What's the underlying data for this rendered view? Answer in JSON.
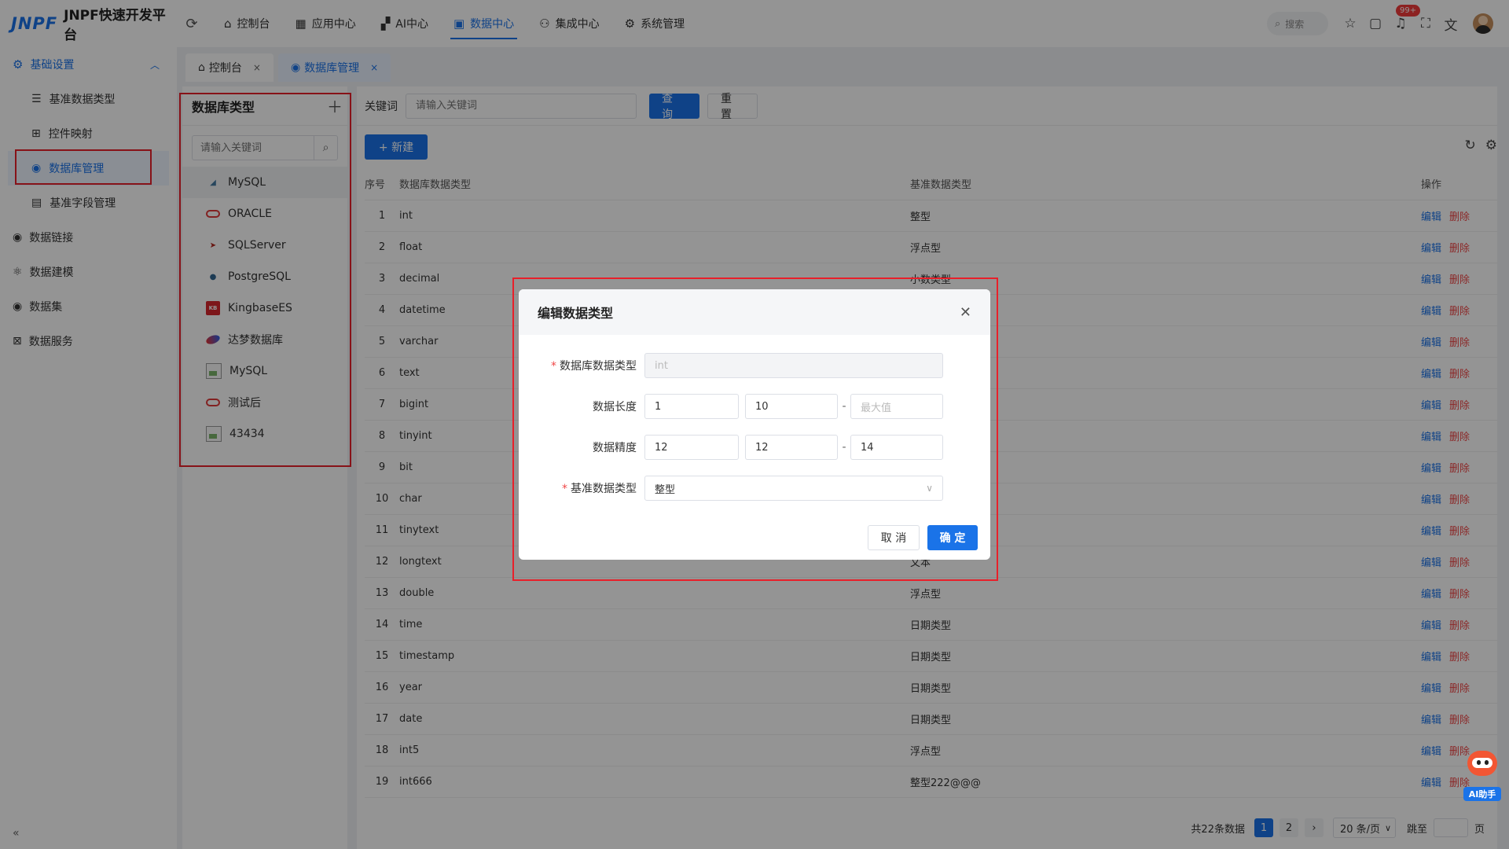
{
  "header": {
    "logo_mark": "JNPF",
    "app_title": "JNPF快速开发平台",
    "nav": [
      {
        "label": "控制台",
        "icon": "home-icon"
      },
      {
        "label": "应用中心",
        "icon": "grid-icon"
      },
      {
        "label": "AI中心",
        "icon": "ai-icon"
      },
      {
        "label": "数据中心",
        "icon": "data-icon",
        "active": true
      },
      {
        "label": "集成中心",
        "icon": "integration-icon"
      },
      {
        "label": "系统管理",
        "icon": "gear-icon"
      }
    ],
    "search_placeholder": "搜索",
    "notification_badge": "99+"
  },
  "sidebar": {
    "group_label": "基础设置",
    "group_items": [
      {
        "label": "基准数据类型"
      },
      {
        "label": "控件映射"
      },
      {
        "label": "数据库管理",
        "active": true
      },
      {
        "label": "基准字段管理"
      }
    ],
    "top_items": [
      {
        "label": "数据链接"
      },
      {
        "label": "数据建模"
      },
      {
        "label": "数据集"
      },
      {
        "label": "数据服务"
      }
    ]
  },
  "tabs": [
    {
      "label": "控制台"
    },
    {
      "label": "数据库管理",
      "active": true
    }
  ],
  "db_panel": {
    "title": "数据库类型",
    "search_placeholder": "请输入关键词",
    "items": [
      {
        "label": "MySQL",
        "logo": "mysql"
      },
      {
        "label": "ORACLE",
        "logo": "oracle"
      },
      {
        "label": "SQLServer",
        "logo": "sqlserver"
      },
      {
        "label": "PostgreSQL",
        "logo": "postgresql"
      },
      {
        "label": "KingbaseES",
        "logo": "kingbase"
      },
      {
        "label": "达梦数据库",
        "logo": "dameng"
      },
      {
        "label": "MySQL",
        "logo": "image"
      },
      {
        "label": "测试后",
        "logo": "oracle"
      },
      {
        "label": "43434",
        "logo": "image"
      }
    ]
  },
  "filter": {
    "keyword_label": "关键词",
    "keyword_placeholder": "请输入关键词",
    "query_label": "查 询",
    "reset_label": "重 置"
  },
  "toolbar": {
    "new_label": "+ 新建"
  },
  "table": {
    "columns": [
      "序号",
      "数据库数据类型",
      "基准数据类型",
      "操作"
    ],
    "edit_label": "编辑",
    "delete_label": "删除",
    "rows": [
      {
        "idx": "1",
        "db_type": "int",
        "base_type": "整型"
      },
      {
        "idx": "2",
        "db_type": "float",
        "base_type": "浮点型"
      },
      {
        "idx": "3",
        "db_type": "decimal",
        "base_type": "小数类型"
      },
      {
        "idx": "4",
        "db_type": "datetime",
        "base_type": ""
      },
      {
        "idx": "5",
        "db_type": "varchar",
        "base_type": ""
      },
      {
        "idx": "6",
        "db_type": "text",
        "base_type": ""
      },
      {
        "idx": "7",
        "db_type": "bigint",
        "base_type": ""
      },
      {
        "idx": "8",
        "db_type": "tinyint",
        "base_type": ""
      },
      {
        "idx": "9",
        "db_type": "bit",
        "base_type": ""
      },
      {
        "idx": "10",
        "db_type": "char",
        "base_type": ""
      },
      {
        "idx": "11",
        "db_type": "tinytext",
        "base_type": ""
      },
      {
        "idx": "12",
        "db_type": "longtext",
        "base_type": "文本"
      },
      {
        "idx": "13",
        "db_type": "double",
        "base_type": "浮点型"
      },
      {
        "idx": "14",
        "db_type": "time",
        "base_type": "日期类型"
      },
      {
        "idx": "15",
        "db_type": "timestamp",
        "base_type": "日期类型"
      },
      {
        "idx": "16",
        "db_type": "year",
        "base_type": "日期类型"
      },
      {
        "idx": "17",
        "db_type": "date",
        "base_type": "日期类型"
      },
      {
        "idx": "18",
        "db_type": "int5",
        "base_type": "浮点型"
      },
      {
        "idx": "19",
        "db_type": "int666",
        "base_type": "整型222@@@"
      }
    ]
  },
  "pagination": {
    "total_text": "共22条数据",
    "pages": [
      "1",
      "2"
    ],
    "current_page": "1",
    "page_size": "20 条/页",
    "jump_label": "跳至",
    "page_suffix": "页"
  },
  "modal": {
    "title": "编辑数据类型",
    "db_type_label": "数据库数据类型",
    "db_type_value": "int",
    "length_label": "数据长度",
    "length_default": "1",
    "length_min": "10",
    "length_max_placeholder": "最大值",
    "precision_label": "数据精度",
    "precision_default": "12",
    "precision_min": "12",
    "precision_max": "14",
    "base_type_label": "基准数据类型",
    "base_type_value": "整型",
    "cancel_label": "取 消",
    "ok_label": "确 定"
  },
  "ai_assistant": {
    "label": "AI助手"
  },
  "colors": {
    "primary": "#1a73e8",
    "danger": "#f04848",
    "highlight": "#e8202a"
  }
}
